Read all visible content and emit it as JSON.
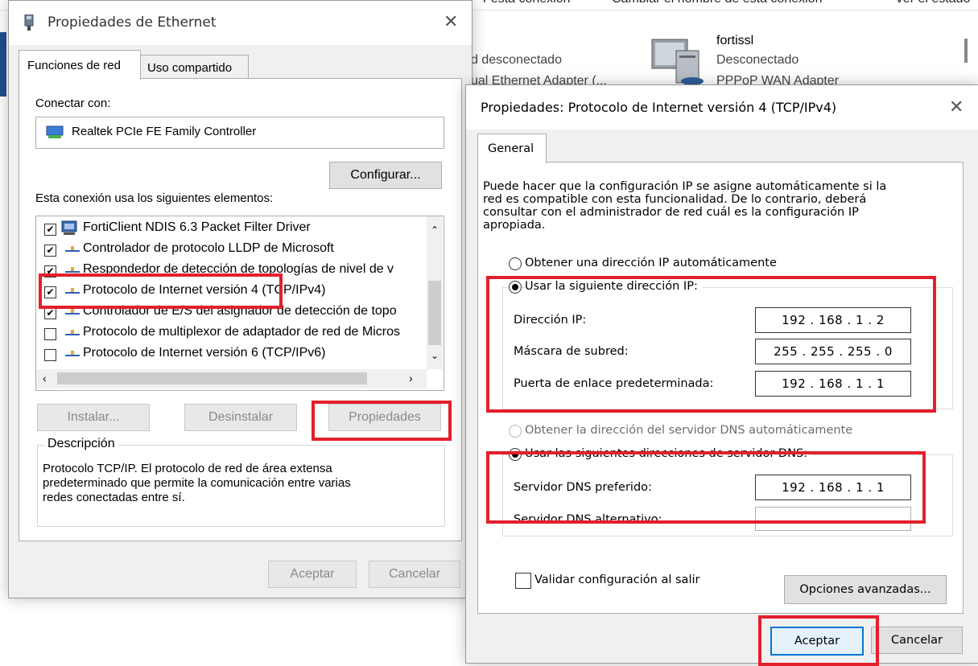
{
  "background": {
    "top_links": [
      "Cambiar el nombre de esta conexión",
      "Ver el estado"
    ],
    "top_partial_left": "r esta conexión",
    "connection_left": {
      "status": "d desconectado",
      "adapter": "ual Ethernet Adapter (..."
    },
    "connection_right": {
      "name": "fortissl",
      "status": "Desconectado",
      "adapter": "PPPoP WAN Adapter"
    }
  },
  "ethernet_dialog": {
    "title": "Propiedades de Ethernet",
    "tabs": [
      "Funciones de red",
      "Uso compartido"
    ],
    "connect_with_label": "Conectar con:",
    "adapter_name": "Realtek PCIe FE Family Controller",
    "configure_button": "Configurar...",
    "elements_label": "Esta conexión usa los siguientes elementos:",
    "items": [
      {
        "label": "FortiClient NDIS 6.3 Packet Filter Driver",
        "checked": true,
        "icon": "forticlient-icon"
      },
      {
        "label": "Controlador de protocolo LLDP de Microsoft",
        "checked": true,
        "icon": "protocol-icon"
      },
      {
        "label": "Respondedor de detección de topologías de nivel de v",
        "checked": true,
        "icon": "protocol-icon"
      },
      {
        "label": "Protocolo de Internet versión 4 (TCP/IPv4)",
        "checked": true,
        "icon": "protocol-icon"
      },
      {
        "label": "Controlador de E/S del asignador de detección de topo",
        "checked": true,
        "icon": "protocol-icon"
      },
      {
        "label": "Protocolo de multiplexor de adaptador de red de Micros",
        "checked": false,
        "icon": "protocol-icon"
      },
      {
        "label": "Protocolo de Internet versión 6 (TCP/IPv6)",
        "checked": false,
        "icon": "protocol-icon"
      }
    ],
    "install_button": "Instalar...",
    "uninstall_button": "Desinstalar",
    "properties_button": "Propiedades",
    "description_legend": "Descripción",
    "description_text": [
      "Protocolo TCP/IP. El protocolo de red de área extensa",
      "predeterminado que permite la comunicación entre varias",
      "redes conectadas entre sí."
    ],
    "ok_button": "Aceptar",
    "cancel_button": "Cancelar"
  },
  "ipv4_dialog": {
    "title": "Propiedades: Protocolo de Internet versión 4 (TCP/IPv4)",
    "tab": "General",
    "intro": [
      "Puede hacer que la configuración IP se asigne automáticamente si la",
      "red es compatible con esta funcionalidad. De lo contrario, deberá",
      "consultar con el administrador de red cuál es la configuración IP",
      "apropiada."
    ],
    "ip_auto_option": "Obtener una dirección IP automáticamente",
    "ip_manual_option": "Usar la siguiente dirección IP:",
    "ip_address_label": "Dirección IP:",
    "ip_address": "192 . 168 .   1  .   2",
    "subnet_label": "Máscara de subred:",
    "subnet": "255 . 255 . 255 .   0",
    "gateway_label": "Puerta de enlace predeterminada:",
    "gateway": "192 . 168 .   1  .   1",
    "dns_auto_option": "Obtener la dirección del servidor DNS automáticamente",
    "dns_manual_option": "Usar las siguientes direcciones de servidor DNS:",
    "preferred_dns_label": "Servidor DNS preferido:",
    "preferred_dns": "192 . 168 .   1  .   1",
    "alternate_dns_label": "Servidor DNS alternativo:",
    "alternate_dns": ".       .       .",
    "validate_label": "Validar configuración al salir",
    "advanced_button": "Opciones avanzadas...",
    "ok_button": "Aceptar",
    "cancel_button": "Cancelar"
  },
  "colors": {
    "highlight_red": "#e2202c",
    "focus_blue": "#0078d7"
  }
}
